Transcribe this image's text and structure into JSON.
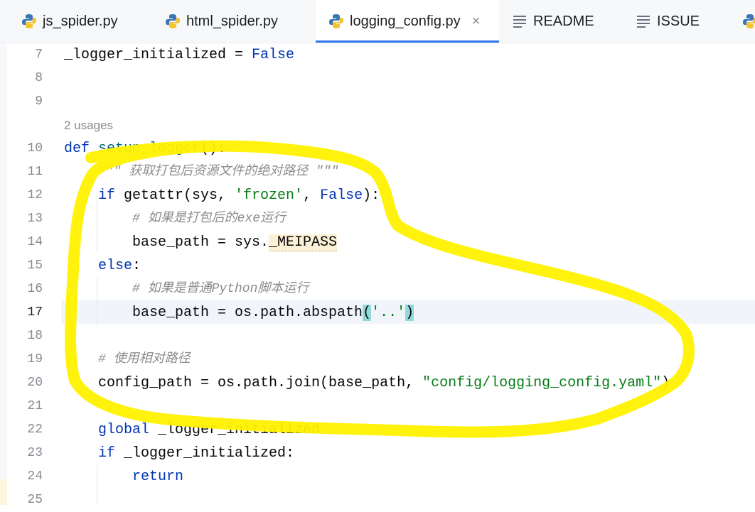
{
  "tabs": [
    {
      "label": "js_spider.py",
      "icon": "python-icon"
    },
    {
      "label": "html_spider.py",
      "icon": "python-icon"
    },
    {
      "label": "logging_config.py",
      "icon": "python-icon",
      "active": true,
      "close": "×"
    },
    {
      "label": "README",
      "icon": "text-lines-icon"
    },
    {
      "label": "ISSUE",
      "icon": "text-lines-icon"
    }
  ],
  "editor": {
    "current_line": "17",
    "usage_hint": "2 usages",
    "line_numbers": [
      "7",
      "8",
      "9",
      "10",
      "11",
      "12",
      "13",
      "14",
      "15",
      "16",
      "17",
      "18",
      "19",
      "20",
      "21",
      "22",
      "23",
      "24",
      "25"
    ],
    "lines": {
      "l7_a": "_logger_initialized = ",
      "l7_b": "False",
      "l10_def": "def ",
      "l10_fn": "setup_logger",
      "l10_rest": "():",
      "l11_doc": "\"\"\" 获取打包后资源文件的绝对路径 \"\"\"",
      "l12_if": "if ",
      "l12_a": "getattr(sys, ",
      "l12_str": "'frozen'",
      "l12_b": ", ",
      "l12_false": "False",
      "l12_c": "):",
      "l13_cm": "# 如果是打包后的exe运行",
      "l14_a": "base_path = sys.",
      "l14_meipass": "_MEIPASS",
      "l15_else": "else",
      "l15_colon": ":",
      "l16_cm": "# 如果是普通Python脚本运行",
      "l17_a": "base_path = os.path.abspath",
      "l17_open": "(",
      "l17_str": "'..'",
      "l17_close": ")",
      "l19_cm": "# 使用相对路径",
      "l20_a": "config_path = os.path.join(base_path, ",
      "l20_str": "\"config/logging_config.yaml\"",
      "l20_b": ")",
      "l22_kw": "global ",
      "l22_a": "_logger_initialized",
      "l23_kw": "if ",
      "l23_a": "_logger_initialized:",
      "l24_kw": "return"
    }
  },
  "annotation": {
    "color": "#fff200",
    "shape": "freehand-loop"
  },
  "colors": {
    "keyword": "#0033b3",
    "function": "#00627a",
    "string": "#067d17",
    "comment": "#8c8c8c",
    "tab_underline": "#3574f0"
  }
}
